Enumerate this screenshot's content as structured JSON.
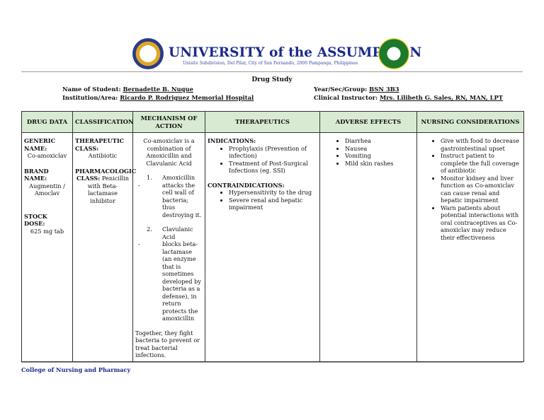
{
  "header": {
    "university_name": "UNIVERSITY of the ASSUMPTION",
    "address": "Unisite Subdivision, Del Pilar, City of San Fernando, 2000 Pampanga, Philippines"
  },
  "document": {
    "title": "Drug Study",
    "student_label": "Name of Student:",
    "student_value": "Bernadette B. Nuque",
    "institution_label": "Institution/Area:",
    "institution_value": "Ricardo P. Rodriguez Memorial Hospital",
    "year_label": "Year/Sec/Group:",
    "year_value": "BSN 3B3",
    "instructor_label": "Clinical Instructor:",
    "instructor_value": "Mrs. Lilibeth G. Sales, RN, MAN, LPT"
  },
  "table": {
    "headers": [
      "DRUG DATA",
      "CLASSIFICATION",
      "MECHANISM OF ACTION",
      "THERAPEUTICS",
      "ADVERSE EFFECTS",
      "NURSING CONSIDERATIONS"
    ],
    "drug_data": {
      "generic_label": "GENERIC NAME:",
      "generic_value": "Co-amoxiclav",
      "brand_label": "BRAND NAME:",
      "brand_value": "Augmentin / Amoclav",
      "stock_label": "STOCK DOSE:",
      "stock_value": "625 mg tab"
    },
    "classification": {
      "therapeutic_label": "THERAPEUTIC CLASS:",
      "therapeutic_value": "Antibiotic",
      "pharmacologic_label": "PHARMACOLOGIC CLASS:",
      "pharmacologic_inline": "Penicillin",
      "pharmacologic_rest": "with Beta-lactamase inhibitor"
    },
    "mechanism": {
      "intro": "Co-amoxiclav is a combination of Amoxicillin and Clavulanic Acid",
      "step1_num": "1.",
      "step1_title": "Amoxicillin",
      "step1_dash": "-",
      "step1_desc": "attacks the cell wall of bacteria; thus destroying it.",
      "step2_num": "2.",
      "step2_title": "Clavulanic Acid",
      "step2_dash": "-",
      "step2_desc": "blocks beta-lactamase (an enzyme that is sometimes developed by bacteria as a defense), in return protects the amoxicillin",
      "conclusion": "Together, they fight bacteria to prevent or treat bacterial infections."
    },
    "therapeutics": {
      "indications_label": "INDICATIONS:",
      "indications": [
        "Prophylaxis (Prevention of infection)",
        "Treatment of Post-Surgical Infections (eg. SSI)"
      ],
      "contraindications_label": "CONTRAINDICATIONS:",
      "contraindications": [
        "Hypersensitivity to the drug",
        "Severe renal and hepatic impairment"
      ]
    },
    "adverse_effects": [
      "Diarrhea",
      "Nausea",
      "Vomiting",
      "Mild skin rashes"
    ],
    "nursing_considerations": [
      "Give with food to decrease gastrointestinal upset",
      "Instruct patient to complete the full coverage of antibiotic",
      "Monitor kidney and liver function as Co-amoxiclav can cause renal and hepatic impairment",
      "Warn patients about potential interactions with oral contraceptives as Co-amoxiclav may reduce their effectiveness"
    ]
  },
  "footer": {
    "college": "College of Nursing and Pharmacy"
  }
}
